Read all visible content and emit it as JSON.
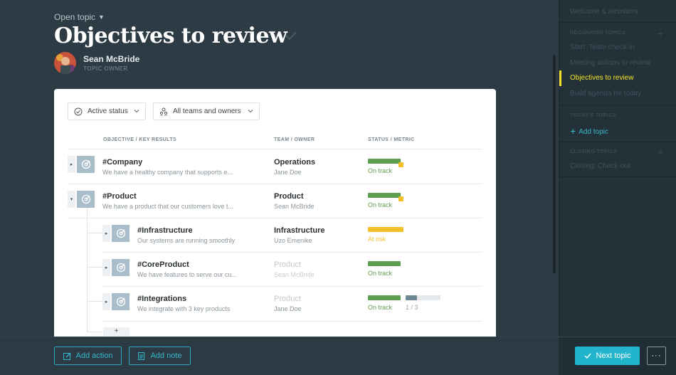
{
  "header": {
    "open_topic": "Open topic",
    "title": "Objectives to review",
    "owner_name": "Sean McBride",
    "owner_role": "TOPIC OWNER"
  },
  "filters": {
    "status": "Active status",
    "teams": "All teams and owners"
  },
  "columns": {
    "objective": "OBJECTIVE / KEY RESULTS",
    "team": "TEAM / OWNER",
    "status": "STATUS / METRIC"
  },
  "objectives": [
    {
      "name": "#Company",
      "description": "We have a healthy company that supports e...",
      "team": "Operations",
      "owner": "Jane Doe",
      "status": "On track",
      "progress": 1.0,
      "color": "#5f9e4f",
      "flag": true
    },
    {
      "name": "#Product",
      "description": "We have a product that our customers love t...",
      "team": "Product",
      "owner": "Sean McBride",
      "status": "On track",
      "progress": 1.0,
      "color": "#5f9e4f",
      "flag": true
    },
    {
      "name": "#Infrastructure",
      "description": "Our systems are running smoothly",
      "team": "Infrastructure",
      "owner": "Uzo Emenike",
      "status": "At risk",
      "progress": 1.0,
      "color": "#f2c027",
      "flag": false
    },
    {
      "name": "#CoreProduct",
      "description": "We have features to serve our cu...",
      "team": "Product",
      "owner": "Sean McBride",
      "status": "On track",
      "progress": 1.0,
      "color": "#5f9e4f",
      "flag": false
    },
    {
      "name": "#Integrations",
      "description": "We integrate with 3 key products",
      "team": "Product",
      "owner": "Jane Doe",
      "status": "On track",
      "progress": 1.0,
      "color": "#5f9e4f",
      "flag": false,
      "metric": "1 / 3",
      "metric_progress": 0.33
    }
  ],
  "sidebar": {
    "welcome": "Welcome & members",
    "recurring_head": "RECURRING TOPICS",
    "recurring": [
      "Start: Team check-in",
      "Meeting actions to review",
      "Objectives to review",
      "Build agenda for today"
    ],
    "today_head": "TODAY'S TOPICS",
    "add_topic": "Add topic",
    "closing_head": "CLOSING TOPICS",
    "closing": [
      "Closing: Check-out"
    ]
  },
  "footer": {
    "add_action": "Add action",
    "add_note": "Add note",
    "next_topic": "Next topic",
    "more": "···"
  },
  "colors": {
    "accent": "#22b4cb",
    "active_topic": "#f3e22c",
    "on_track": "#5f9e4f",
    "at_risk": "#f2c027"
  }
}
